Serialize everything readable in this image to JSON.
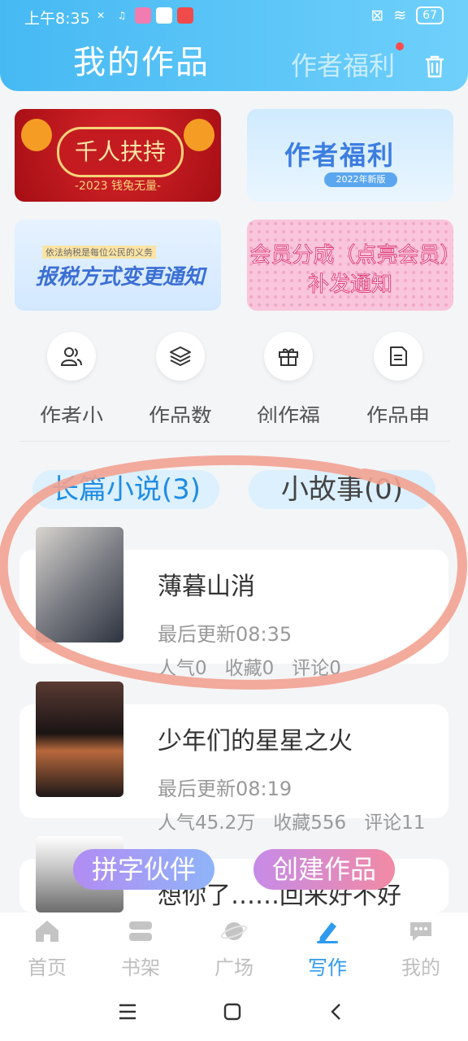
{
  "status_bar": {
    "time": "上午8:35",
    "battery": "67"
  },
  "header": {
    "title": "我的作品",
    "welfare_link": "作者福利"
  },
  "banners": [
    {
      "title": "千人扶持",
      "subtitle": "-2023 钱兔无量-"
    },
    {
      "title": "作者福利",
      "subtitle": "2022年新版"
    },
    {
      "title": "报税方式变更通知",
      "subtitle": "依法纳税是每位公民的义务"
    },
    {
      "title": "会员分成（点亮会员）补发通知"
    }
  ],
  "quick_actions": [
    {
      "label": "作者小",
      "icon": "people-icon"
    },
    {
      "label": "作品数",
      "icon": "layers-icon"
    },
    {
      "label": "创作福",
      "icon": "gift-icon"
    },
    {
      "label": "作品申",
      "icon": "document-icon"
    }
  ],
  "tabs": [
    {
      "label": "长篇小说(3)"
    },
    {
      "label": "小故事(0)"
    }
  ],
  "works": [
    {
      "title": "薄暮山消",
      "updated": "最后更新08:35",
      "popularity": "人气0",
      "favorites": "收藏0",
      "comments": "评论0"
    },
    {
      "title": "少年们的星星之火",
      "updated": "最后更新08:19",
      "popularity": "人气45.2万",
      "favorites": "收藏556",
      "comments": "评论11"
    },
    {
      "title": "想你了……回来好不好"
    }
  ],
  "floating_buttons": {
    "partner": "拼字伙伴",
    "create": "创建作品"
  },
  "bottom_nav": [
    {
      "label": "首页",
      "icon": "home-icon"
    },
    {
      "label": "书架",
      "icon": "bookshelf-icon"
    },
    {
      "label": "广场",
      "icon": "planet-icon"
    },
    {
      "label": "写作",
      "icon": "pen-icon"
    },
    {
      "label": "我的",
      "icon": "chat-icon"
    }
  ],
  "colors": {
    "header": "#46b9f3",
    "accent": "#2f9bef",
    "annotation": "#f2a291"
  }
}
